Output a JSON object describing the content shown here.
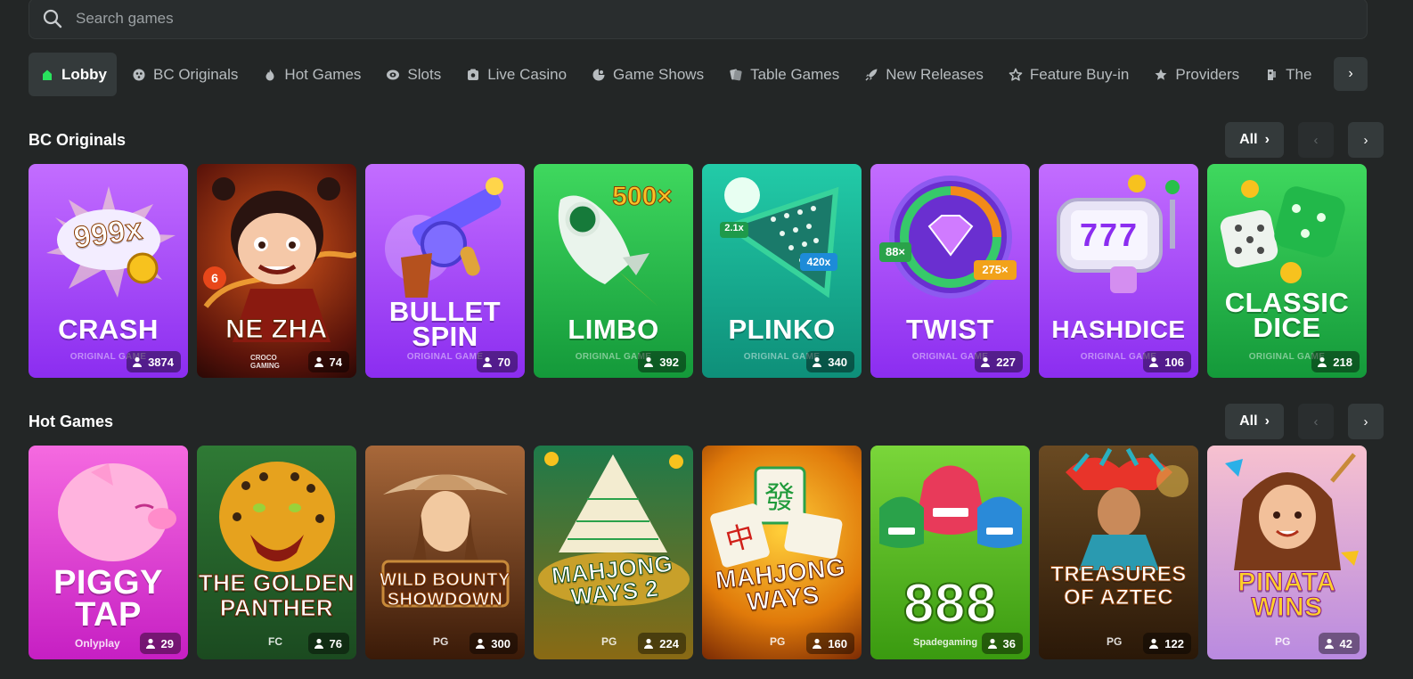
{
  "search": {
    "placeholder": "Search games"
  },
  "tabs": [
    {
      "label": "Lobby",
      "icon": "home-icon",
      "active": true
    },
    {
      "label": "BC Originals",
      "icon": "originals-icon"
    },
    {
      "label": "Hot Games",
      "icon": "flame-icon"
    },
    {
      "label": "Slots",
      "icon": "slots-icon"
    },
    {
      "label": "Live Casino",
      "icon": "live-casino-icon"
    },
    {
      "label": "Game Shows",
      "icon": "game-shows-icon"
    },
    {
      "label": "Table Games",
      "icon": "table-games-icon"
    },
    {
      "label": "New Releases",
      "icon": "rocket-icon"
    },
    {
      "label": "Feature Buy-in",
      "icon": "star-outline-icon"
    },
    {
      "label": "Providers",
      "icon": "star-icon"
    },
    {
      "label": "The",
      "icon": "theme-icon"
    }
  ],
  "sections": [
    {
      "title": "BC Originals",
      "all_label": "All",
      "games": [
        {
          "title": "CRASH",
          "art_text": "999x",
          "sub": "ORIGINAL GAME",
          "players": "3874",
          "bg": [
            "#c06cff",
            "#8a2be2"
          ]
        },
        {
          "title": "NE ZHA",
          "art_text": "6",
          "brand": "CROCO GAMING",
          "players": "74",
          "bg": [
            "#c2410c",
            "#3b0a05"
          ]
        },
        {
          "title": "BULLET SPIN",
          "sub": "ORIGINAL GAME",
          "players": "70",
          "bg": [
            "#c06cff",
            "#8a2be2"
          ]
        },
        {
          "title": "LIMBO",
          "art_text": "500×",
          "sub": "ORIGINAL GAME",
          "players": "392",
          "bg": [
            "#3ad45c",
            "#15993a"
          ]
        },
        {
          "title": "PLINKO",
          "art_text_1": "2.1x",
          "art_text_2": "420x",
          "sub": "ORIGINAL GAME",
          "players": "340",
          "bg": [
            "#22c9a6",
            "#0f8f7a"
          ]
        },
        {
          "title": "TWIST",
          "art_text_1": "88×",
          "art_text_2": "275×",
          "sub": "ORIGINAL GAME",
          "players": "227",
          "bg": [
            "#c06cff",
            "#8a2be2"
          ]
        },
        {
          "title": "HASHDICE",
          "art_text": "777",
          "sub": "ORIGINAL GAME",
          "players": "106",
          "bg": [
            "#c06cff",
            "#8a2be2"
          ]
        },
        {
          "title": "CLASSIC DICE",
          "sub": "ORIGINAL GAME",
          "players": "218",
          "bg": [
            "#3ad45c",
            "#15993a"
          ]
        }
      ]
    },
    {
      "title": "Hot Games",
      "all_label": "All",
      "games": [
        {
          "title": "PIGGY TAP",
          "brand": "Onlyplay",
          "players": "29",
          "bg": [
            "#f04fd8",
            "#c322c0"
          ]
        },
        {
          "title": "THE GOLDEN PANTHER",
          "brand": "FC",
          "players": "76",
          "bg": [
            "#2f7a35",
            "#1b4a20"
          ]
        },
        {
          "title": "WILD BOUNTY SHOWDOWN",
          "brand": "PG",
          "players": "300",
          "bg": [
            "#9a5a2a",
            "#4a2410"
          ]
        },
        {
          "title": "MAHJONG WAYS 2",
          "brand": "PG",
          "players": "224",
          "bg": [
            "#1f7a4a",
            "#7a5a10"
          ]
        },
        {
          "title": "MAHJONG WAYS",
          "brand": "PG",
          "players": "160",
          "bg": [
            "#e89a12",
            "#8a3a05"
          ]
        },
        {
          "title": "888",
          "brand": "Spadegaming",
          "players": "36",
          "bg": [
            "#6fd12a",
            "#3a9a10"
          ]
        },
        {
          "title": "TREASURES OF AZTEC",
          "brand": "PG",
          "players": "122",
          "bg": [
            "#5a3a1a",
            "#2a1a0a"
          ]
        },
        {
          "title": "PINATA WINS",
          "brand": "PG",
          "players": "42",
          "bg": [
            "#f2a0b8",
            "#c07ad8"
          ]
        }
      ]
    }
  ]
}
